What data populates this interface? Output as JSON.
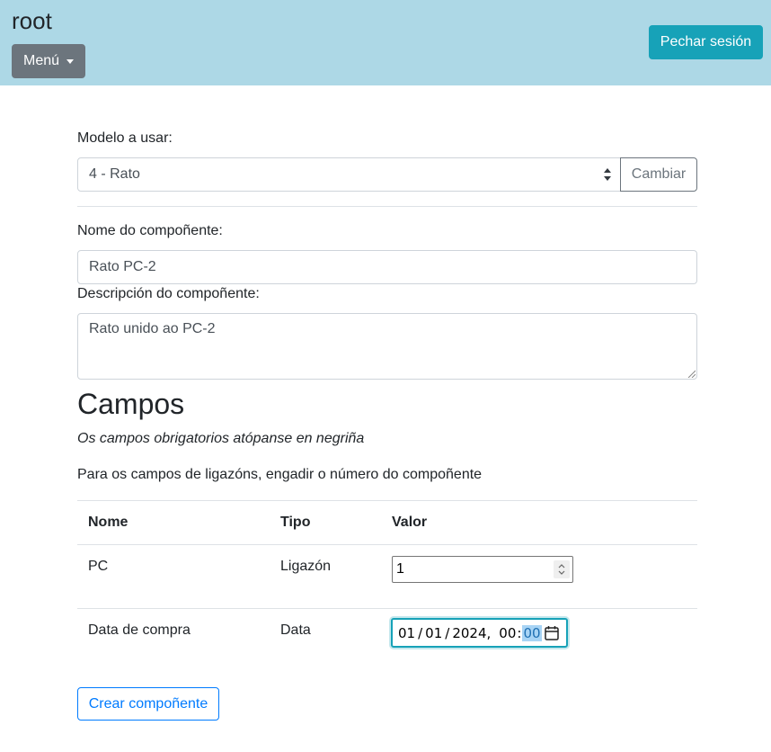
{
  "navbar": {
    "brand": "root",
    "menu_label": "Menú",
    "logout_label": "Pechar sesión"
  },
  "model": {
    "label": "Modelo a usar:",
    "selected": "4 - Rato",
    "change_label": "Cambiar"
  },
  "component": {
    "name_label": "Nome do compoñente:",
    "name_value": "Rato PC-2",
    "desc_label": "Descripción do compoñente:",
    "desc_value": "Rato unido ao PC-2"
  },
  "fields": {
    "title": "Campos",
    "note_required": "Os campos obrigatorios atópanse en negriña",
    "note_links": "Para os campos de ligazóns, engadir o número do compoñente",
    "columns": [
      "Nome",
      "Tipo",
      "Valor"
    ],
    "rows": [
      {
        "name": "PC",
        "type": "Ligazón",
        "value": "1"
      },
      {
        "name": "Data de compra",
        "type": "Data",
        "value": {
          "day": "01",
          "month": "01",
          "year": "2024",
          "hour": "00",
          "minute": "00"
        }
      }
    ]
  },
  "create_label": "Crear compoñente",
  "colors": {
    "navbar_bg": "#add8e6",
    "logout_bg": "#17a2b8",
    "menu_bg": "#6c757d",
    "primary": "#007bff"
  }
}
